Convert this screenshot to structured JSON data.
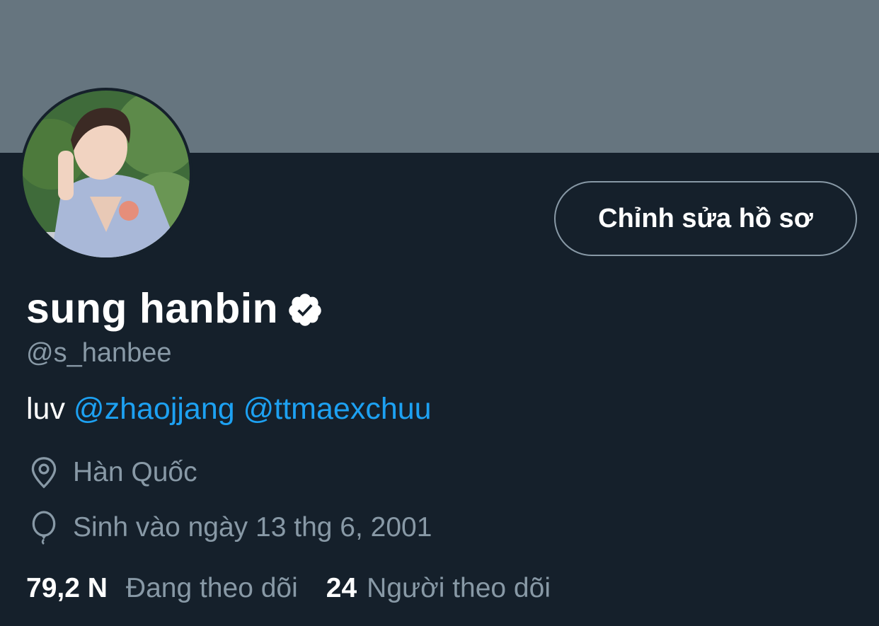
{
  "profile": {
    "display_name": "sung hanbin",
    "handle": "@s_hanbee",
    "verified_icon": "verified-badge-icon",
    "bio": {
      "prefix": "luv ",
      "mention_1": "@zhaojjang",
      "mention_2": "@ttmaexchuu"
    },
    "location": "Hàn Quốc",
    "birthday": "Sinh vào ngày 13 thg 6, 2001"
  },
  "actions": {
    "edit_profile_label": "Chỉnh sửa hồ sơ"
  },
  "stats": {
    "following_count": "79,2 N",
    "following_label": "Đang theo dõi",
    "followers_count": "24",
    "followers_label": "Người theo dõi"
  },
  "colors": {
    "background": "#15202b",
    "banner": "#66757f",
    "secondary_text": "#8899a6",
    "link": "#1da1f2"
  }
}
